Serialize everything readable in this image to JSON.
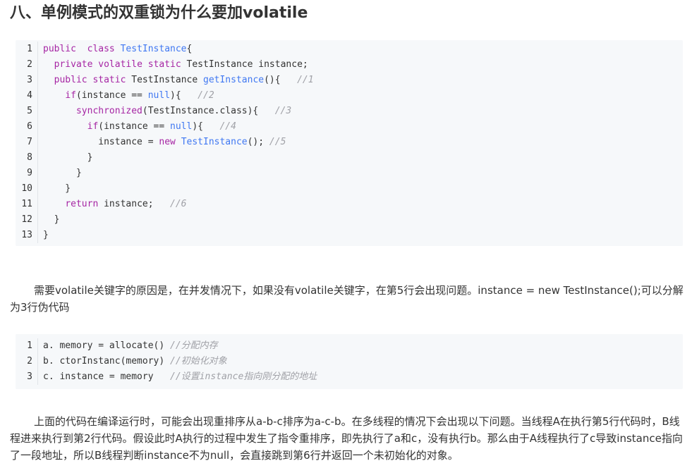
{
  "heading": "八、单例模式的双重锁为什么要加volatile",
  "code1": {
    "lines": [
      {
        "n": "1",
        "segs": [
          [
            "kw",
            "public"
          ],
          [
            "",
            "  "
          ],
          [
            "kw",
            "class"
          ],
          [
            "",
            " "
          ],
          [
            "ty",
            "TestInstance"
          ],
          [
            "",
            "{"
          ]
        ]
      },
      {
        "n": "2",
        "segs": [
          [
            "",
            "  "
          ],
          [
            "kw",
            "private"
          ],
          [
            "",
            " "
          ],
          [
            "kw",
            "volatile"
          ],
          [
            "",
            " "
          ],
          [
            "kw",
            "static"
          ],
          [
            "",
            " TestInstance instance;"
          ]
        ]
      },
      {
        "n": "3",
        "segs": [
          [
            "",
            "  "
          ],
          [
            "kw",
            "public"
          ],
          [
            "",
            " "
          ],
          [
            "kw",
            "static"
          ],
          [
            "",
            " TestInstance "
          ],
          [
            "ty",
            "getInstance"
          ],
          [
            "",
            "(){   "
          ],
          [
            "cm",
            "//1"
          ]
        ]
      },
      {
        "n": "4",
        "segs": [
          [
            "",
            "    "
          ],
          [
            "kw",
            "if"
          ],
          [
            "",
            "(instance == "
          ],
          [
            "lit",
            "null"
          ],
          [
            "",
            "){   "
          ],
          [
            "cm",
            "//2"
          ]
        ]
      },
      {
        "n": "5",
        "segs": [
          [
            "",
            "      "
          ],
          [
            "kw",
            "synchronized"
          ],
          [
            "",
            "(TestInstance.class){   "
          ],
          [
            "cm",
            "//3"
          ]
        ]
      },
      {
        "n": "6",
        "segs": [
          [
            "",
            "        "
          ],
          [
            "kw",
            "if"
          ],
          [
            "",
            "(instance == "
          ],
          [
            "lit",
            "null"
          ],
          [
            "",
            "){   "
          ],
          [
            "cm",
            "//4"
          ]
        ]
      },
      {
        "n": "7",
        "segs": [
          [
            "",
            "          instance = "
          ],
          [
            "kw",
            "new"
          ],
          [
            "",
            " "
          ],
          [
            "ty",
            "TestInstance"
          ],
          [
            "",
            "(); "
          ],
          [
            "cm",
            "//5"
          ]
        ]
      },
      {
        "n": "8",
        "segs": [
          [
            "",
            "        }"
          ]
        ]
      },
      {
        "n": "9",
        "segs": [
          [
            "",
            "      }"
          ]
        ]
      },
      {
        "n": "10",
        "segs": [
          [
            "",
            "    }"
          ]
        ]
      },
      {
        "n": "11",
        "segs": [
          [
            "",
            "    "
          ],
          [
            "kw",
            "return"
          ],
          [
            "",
            " instance;   "
          ],
          [
            "cm",
            "//6"
          ]
        ]
      },
      {
        "n": "12",
        "segs": [
          [
            "",
            "  }"
          ]
        ]
      },
      {
        "n": "13",
        "segs": [
          [
            "",
            "}"
          ]
        ]
      }
    ]
  },
  "para1": "需要volatile关键字的原因是，在并发情况下，如果没有volatile关键字，在第5行会出现问题。instance = new TestInstance();可以分解为3行伪代码",
  "code2": {
    "lines": [
      {
        "n": "1",
        "segs": [
          [
            "",
            "a. memory = allocate() "
          ],
          [
            "cm",
            "//分配内存"
          ]
        ]
      },
      {
        "n": "2",
        "segs": [
          [
            "",
            "b. ctorInstanc(memory) "
          ],
          [
            "cm",
            "//初始化对象"
          ]
        ]
      },
      {
        "n": "3",
        "segs": [
          [
            "",
            "c. instance = memory   "
          ],
          [
            "cm",
            "//设置instance指向刚分配的地址"
          ]
        ]
      }
    ]
  },
  "para2": "上面的代码在编译运行时，可能会出现重排序从a-b-c排序为a-c-b。在多线程的情况下会出现以下问题。当线程A在执行第5行代码时，B线程进来执行到第2行代码。假设此时A执行的过程中发生了指令重排序，即先执行了a和c，没有执行b。那么由于A线程执行了c导致instance指向了一段地址，所以B线程判断instance不为null，会直接跳到第6行并返回一个未初始化的对象。"
}
